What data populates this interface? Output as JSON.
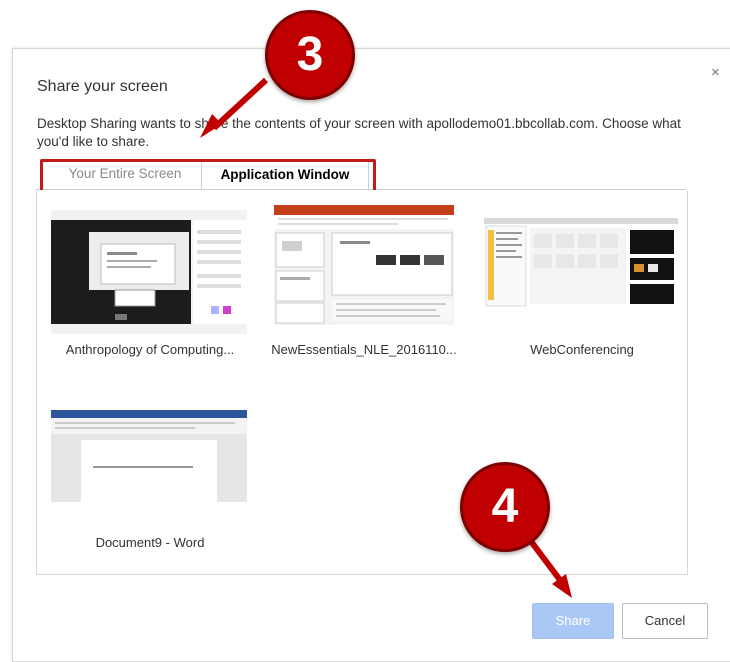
{
  "dialog": {
    "title": "Share your screen",
    "close_icon": "×",
    "description": "Desktop Sharing wants to share the contents of your screen with apollodemo01.bbcollab.com. Choose what you'd like to share."
  },
  "tabs": [
    {
      "label": "Your Entire Screen",
      "selected": false
    },
    {
      "label": "Application Window",
      "selected": true
    }
  ],
  "windows": [
    {
      "label": "Anthropology of Computing..."
    },
    {
      "label": "NewEssentials_NLE_2016110..."
    },
    {
      "label": "WebConferencing"
    },
    {
      "label": "Document9 - Word"
    }
  ],
  "buttons": {
    "share": "Share",
    "cancel": "Cancel"
  },
  "callouts": {
    "step3": "3",
    "step4": "4"
  },
  "colors": {
    "callout": "#c00000",
    "highlight": "#c41a1a",
    "share_button": "#a9c8f5"
  }
}
